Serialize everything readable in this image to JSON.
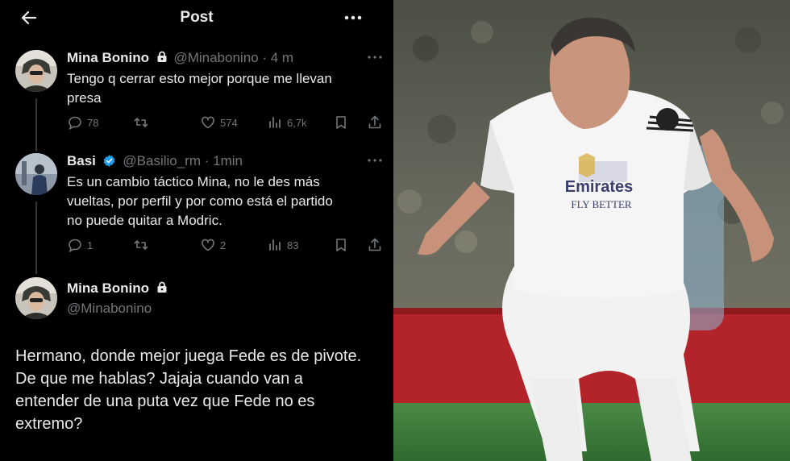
{
  "header": {
    "title": "Post",
    "back_icon": "arrow-left-icon",
    "more_icon": "more-horizontal-icon"
  },
  "tweets": [
    {
      "name": "Mina Bonino",
      "handle": "@Minabonino",
      "time": "· 4 m",
      "locked": true,
      "text_lines": [
        "Tengo q cerrar esto mejor porque me llevan",
        "presa"
      ],
      "replies": "78",
      "retweets": "",
      "likes": "574",
      "views": "6,7k"
    },
    {
      "name": "Basi",
      "handle": "@Basilio_rm",
      "time": "· 1min",
      "verified": true,
      "verified_color": "#1d9bf0",
      "text_lines": [
        "Es un cambio táctico Mina, no le des más",
        "vueltas, por perfil y por como está el partido",
        "no puede quitar a Modric."
      ],
      "replies": "1",
      "retweets": "",
      "likes": "2",
      "views": "83"
    }
  ],
  "focus": {
    "name": "Mina Bonino",
    "handle": "@Minabonino",
    "locked": true,
    "text_lines": [
      "Hermano, donde mejor juega Fede es de pivote.",
      "De que me hablas? Jajaja cuando van a",
      "entender de una puta vez que Fede no es",
      "extremo?"
    ]
  },
  "photo": {
    "jersey_sponsor_lines": [
      "Emirates",
      "FLY BETTER"
    ],
    "colors": {
      "kit": "#f2f2f2",
      "pitch": "#3f7d3a",
      "board": "#b3242a"
    }
  },
  "colors": {
    "background": "#000000",
    "text": "#e7e9ea",
    "muted": "#71767b",
    "verified": "#1d9bf0"
  }
}
